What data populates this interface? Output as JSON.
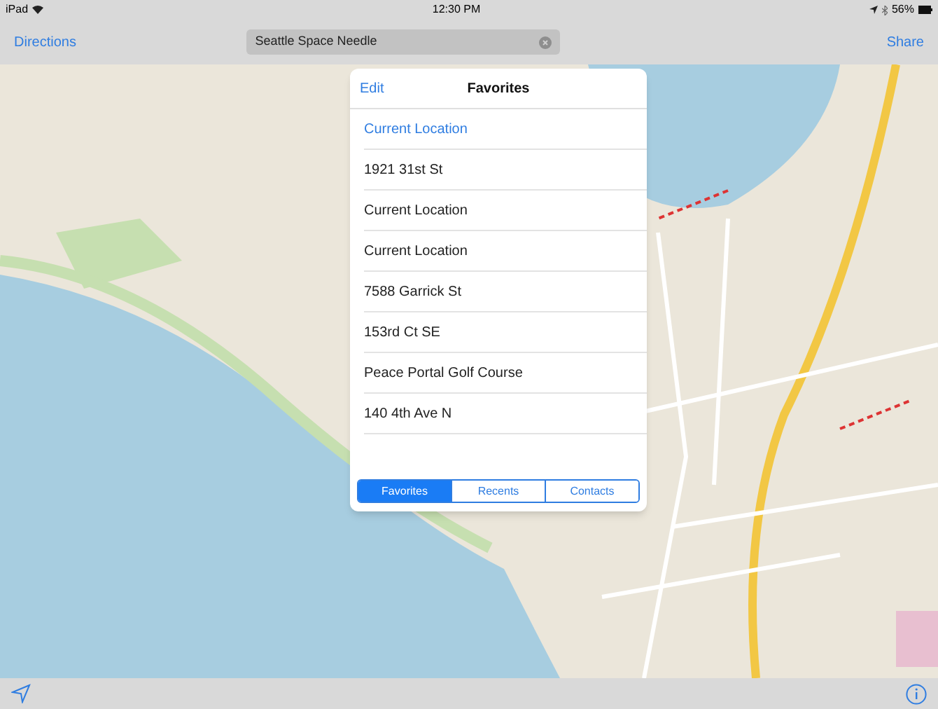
{
  "status_bar": {
    "device": "iPad",
    "time": "12:30 PM",
    "battery": "56%"
  },
  "nav_bar": {
    "left_button": "Directions",
    "search": {
      "value": "Seattle Space Needle"
    },
    "right_button": "Share"
  },
  "popover": {
    "edit_button": "Edit",
    "title": "Favorites",
    "items": [
      {
        "kind": "current",
        "label": "Current Location"
      },
      {
        "kind": "place",
        "label": "1921 31st St"
      },
      {
        "kind": "place",
        "label": "Current Location"
      },
      {
        "kind": "place",
        "label": "Current Location"
      },
      {
        "kind": "place",
        "label": "7588 Garrick St"
      },
      {
        "kind": "place",
        "label": "153rd Ct SE"
      },
      {
        "kind": "place",
        "label": "Peace Portal Golf Course"
      },
      {
        "kind": "place",
        "label": "140 4th Ave N"
      }
    ],
    "segments": [
      {
        "label": "Favorites",
        "selected": true
      },
      {
        "label": "Recents",
        "selected": false
      },
      {
        "label": "Contacts",
        "selected": false
      }
    ]
  }
}
